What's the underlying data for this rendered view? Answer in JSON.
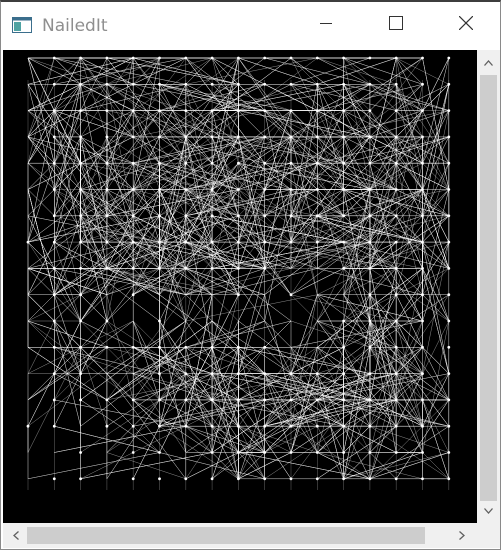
{
  "window": {
    "title": "NailedIt",
    "icon": "app-window-icon"
  },
  "controls": {
    "minimize_icon": "minimize-icon",
    "maximize_icon": "maximize-icon",
    "close_icon": "close-icon"
  },
  "canvas": {
    "description_icon": "string-art-canvas",
    "background": "#000000",
    "thread_color": "#ffffff",
    "grid_cols": 17,
    "grid_rows": 17
  },
  "scrollbars": {
    "vertical": {
      "up_icon": "chevron-up-icon",
      "down_icon": "chevron-down-icon"
    },
    "horizontal": {
      "left_icon": "chevron-left-icon",
      "right_icon": "chevron-right-icon"
    }
  }
}
